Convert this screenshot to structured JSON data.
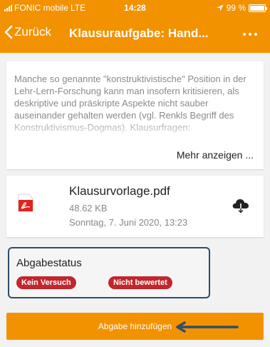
{
  "status_bar": {
    "carrier": "FONIC mobile",
    "network": "LTE",
    "time": "14:28",
    "battery": "99 %",
    "battery_level": 0.99
  },
  "nav": {
    "back_label": "Zurück",
    "title": "Klausuraufgabe: Hand..."
  },
  "description": {
    "text": "Manche so genannte \"konstruktivistische\" Position in der Lehr-Lern-Forschung kann man insofern kritisieren, als deskriptive und präskripte Aspekte nicht sauber auseinander gehalten werden (vgl. Renkls Begriff des Konstruktivismus-Dogmas). Klausurfragen:",
    "show_more": "Mehr anzeigen ..."
  },
  "file": {
    "name": "Klausurvorlage.pdf",
    "size": "48.62 KB",
    "date": "Sonntag, 7. Juni 2020, 13:23"
  },
  "submission_status": {
    "label": "Abgabestatus",
    "badges": [
      "Kein Versuch",
      "Nicht bewertet"
    ]
  },
  "submit_button": "Abgabe hinzufügen",
  "colors": {
    "accent": "#f39200",
    "badge": "#c1272d",
    "highlight_border": "#2d4d6e"
  },
  "icons": [
    "signal-icon",
    "location-arrow-icon",
    "battery-icon",
    "chevron-left-icon",
    "more-icon",
    "pdf-icon",
    "cloud-download-icon",
    "arrow-left-icon"
  ]
}
